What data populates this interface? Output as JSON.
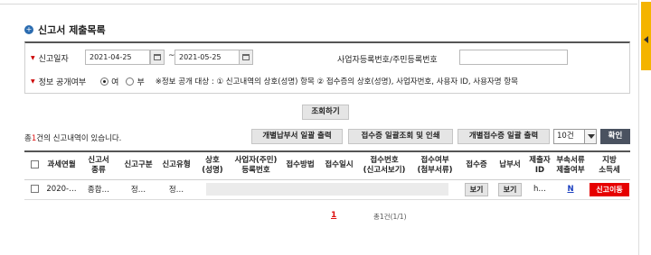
{
  "section_title": "신고서 제출목록",
  "search": {
    "report_date_label": "신고일자",
    "date_from": "2021-04-25",
    "date_to": "2021-05-25",
    "tilde": "~",
    "biz_no_label": "사업자등록번호/주민등록번호",
    "biz_no_value": "",
    "disclosure_label": "정보 공개여부",
    "radio_yes": "여",
    "radio_no": "부",
    "radio_selected": "여",
    "notice": "※정보 공개 대상 : ① 신고내역의 상호(성명) 항목 ② 접수증의 상호(성명), 사업자번호, 사용자 ID, 사용자명 항목",
    "search_button": "조회하기"
  },
  "result": {
    "count_prefix": "총",
    "count_value": "1",
    "count_suffix": "건의 신고내역이 있습니다.",
    "buttons": {
      "bulk_payment": "개별납부서 일괄 출력",
      "bulk_receipt_lookup": "접수증 일괄조회 및 인쇄",
      "bulk_receipt_print": "개별접수증 일괄 출력"
    },
    "page_size": "10건",
    "confirm_button": "확인"
  },
  "table": {
    "headers": [
      "",
      "과세연월",
      "신고서\n종류",
      "신고구분",
      "신고유형",
      "상호\n(성명)",
      "사업자(주민)\n등록번호",
      "접수방법",
      "접수일시",
      "접수번호\n(신고서보기)",
      "접수여부\n(첨부서류)",
      "접수증",
      "납부서",
      "제출자\nID",
      "부속서류\n제출여부",
      "지방\n소득세"
    ],
    "rows": [
      {
        "period": "2020-…",
        "form_type": "종합…",
        "category": "정…",
        "type": "정…",
        "receipt_btn": "보기",
        "payment_btn": "보기",
        "submitter": "h…",
        "attach": "N",
        "local_tax_btn": "신고이동"
      }
    ]
  },
  "pagination": {
    "current": "1",
    "total": "총1건(1/1)"
  },
  "colors": {
    "accent": "#2b6cb0",
    "red": "#e60000",
    "dark_button": "#4a5260"
  }
}
